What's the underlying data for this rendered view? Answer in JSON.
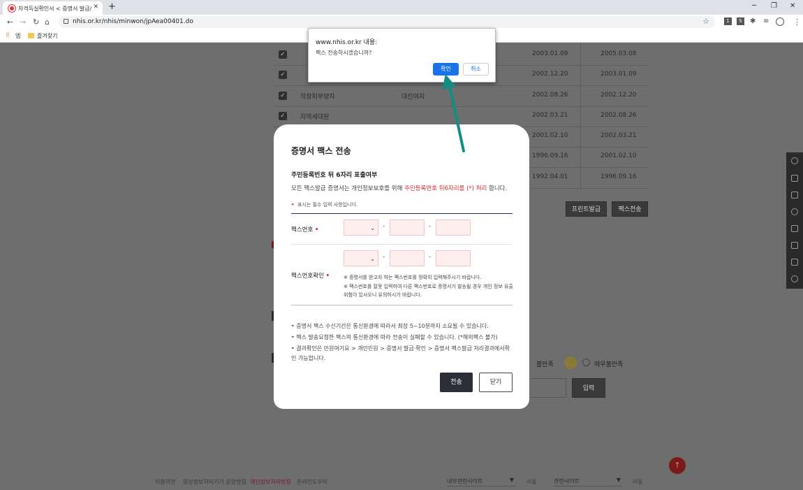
{
  "browser": {
    "tab_title": "자격득실확인서 < 증명서 발급/",
    "url": "nhis.or.kr/nhis/minwon/jpAea00401.do",
    "bookmarks": [
      "앱",
      "즐겨찾기"
    ],
    "extensions": [
      "1",
      "S"
    ]
  },
  "background": {
    "rows": [
      {
        "type": "",
        "mid": "",
        "d1": "2003.01.09",
        "d2": "2005.03.08"
      },
      {
        "type": "",
        "mid": "",
        "d1": "2002.12.20",
        "d2": "2003.01.09"
      },
      {
        "type": "직장피부양자",
        "mid": "대진여자",
        "d1": "2002.08.26",
        "d2": "2002.12.20"
      },
      {
        "type": "지역세대원",
        "mid": "",
        "d1": "2002.03.21",
        "d2": "2002.08.26"
      },
      {
        "type": "",
        "mid": "",
        "d1": "2001.02.10",
        "d2": "2002.03.21"
      },
      {
        "type": "",
        "mid": "",
        "d1": "1996.09.16",
        "d2": "2001.02.10"
      },
      {
        "type": "",
        "mid": "",
        "d1": "1992.04.01",
        "d2": "1996.09.16"
      }
    ],
    "print_btn": "프린트발급",
    "fax_btn": "팩스전송",
    "survey_dissatisfied": "불만족",
    "survey_very_dissatisfied": "매우불만족",
    "input_btn": "입력",
    "footer_links": [
      "이용약관",
      "영상정보처리기기 운영방침",
      "개인정보처리방침",
      "온라인도우미"
    ],
    "related_sites_1": "내부관련사이트",
    "related_sites_2": "관련사이트",
    "go_1": "이동",
    "go_2": "이동"
  },
  "alert": {
    "title": "www.nhis.or.kr 내용:",
    "message": "팩스 전송하시겠습니까?",
    "ok": "확인",
    "cancel": "취소"
  },
  "modal": {
    "title": "증명서 팩스 전송",
    "section_title": "주민등록번호 뒤 6자리 표출여부",
    "desc_prefix": "모든 팩스발급 증명서는 개인정보보호를 위해 ",
    "desc_highlight": "주민등록번호 뒤6자리를 (*) 처리",
    "desc_suffix": " 합니다.",
    "required_note": "표시는 필수 입력 사항입니다.",
    "fax_label": "팩스번호",
    "fax_confirm_label": "팩스번호확인",
    "dash": "-",
    "notes": [
      "※ 증명서를 받고자 하는 팩스번호를 정확히 입력해주시기 바랍니다.",
      "※ 팩스번호를 잘못 입력하여 다른 팩스번호로 증명서가 발송될 경우 개인 정보 유출 위험이 있사오니 유의하시기 바랍니다."
    ],
    "bullets": [
      "• 증명서 팩스 수신기간은 통신환경에 따라서 최장 5~10분까지 소요될 수 있습니다.",
      "• 팩스 발송요청한 팩스의 통신환경에 따라 전송이 실패할 수 있습니다. (*해외팩스 불가)",
      "• 결과확인은 민원여기요 > 개인민원 > 증명서 발급·확인 > 증명서 팩스발급 처리결과에서확인 가능합니다."
    ],
    "send_btn": "전송",
    "close_btn": "닫기"
  },
  "colors": {
    "accent": "#1a73e8",
    "arrow": "#138c84",
    "required": "#d42a2a",
    "dark_btn": "#2b2d38"
  }
}
